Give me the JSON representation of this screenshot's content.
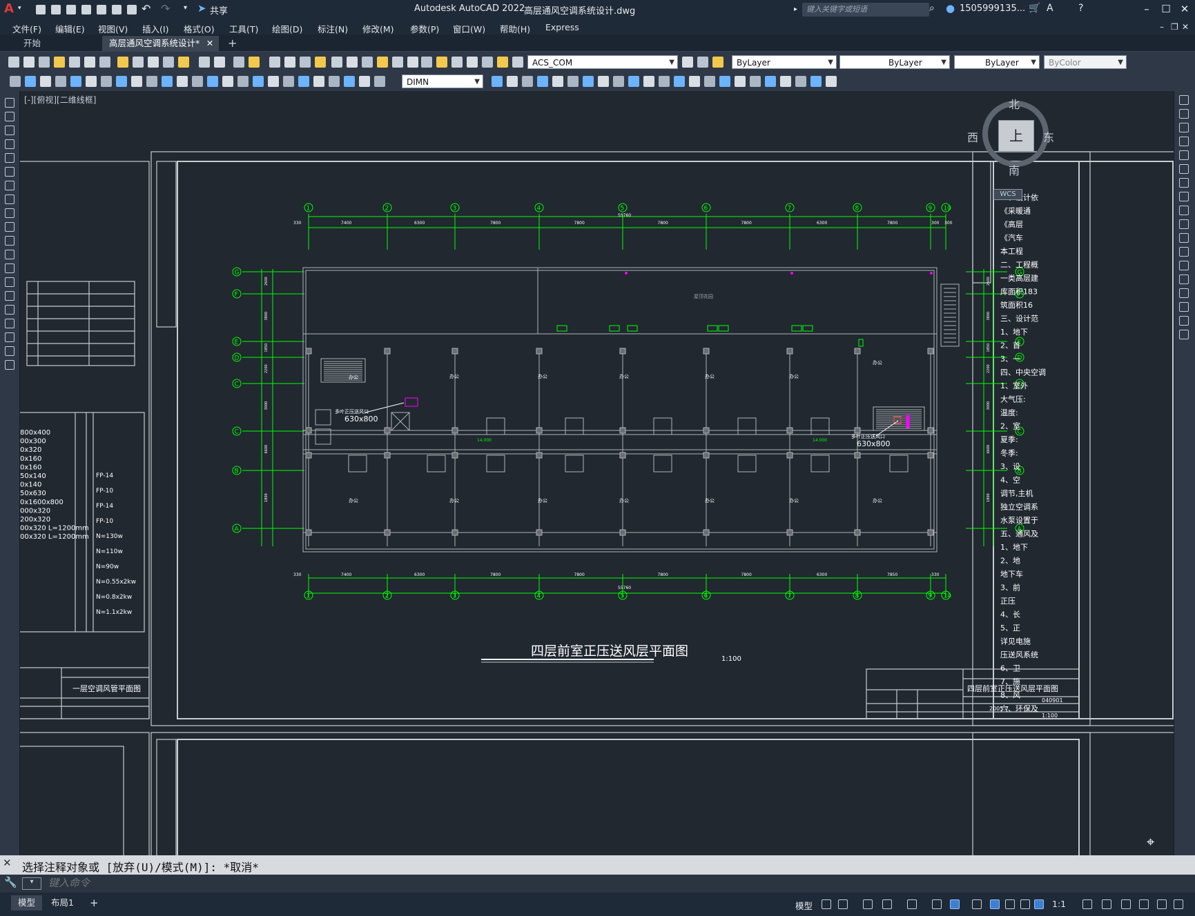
{
  "title_bar": {
    "app_name": "Autodesk AutoCAD 2022",
    "file_name": "高层通风空调系统设计.dwg",
    "share_label": "共享",
    "search_placeholder": "键入关键字或短语",
    "user_id": "1505999135...",
    "help_icon": "?"
  },
  "menu": {
    "items": [
      "文件(F)",
      "编辑(E)",
      "视图(V)",
      "插入(I)",
      "格式(O)",
      "工具(T)",
      "绘图(D)",
      "标注(N)",
      "修改(M)",
      "参数(P)",
      "窗口(W)",
      "帮助(H)",
      "Express"
    ]
  },
  "tabs": {
    "items": [
      {
        "label": "开始"
      },
      {
        "label": "高层通风空调系统设计*",
        "active": true
      }
    ],
    "add_label": "+"
  },
  "properties": {
    "layer": "ACS_COM",
    "color": "ByLayer",
    "linetype": "ByLayer",
    "lineweight": "ByLayer",
    "plotstyle": "ByColor",
    "dimstyle": "DIMN"
  },
  "viewport": {
    "label": "[-][俯视][二维线框]",
    "viewcube": {
      "north": "北",
      "south": "南",
      "east": "东",
      "west": "西",
      "top": "上",
      "wcs": "WCS"
    }
  },
  "drawing": {
    "main_title": "四层前室正压送风层平面图",
    "scale": "1:100",
    "total_dim": "55760",
    "top_dims": [
      "330",
      "7400",
      "6300",
      "7800",
      "7800",
      "7800",
      "7800",
      "6300",
      "7800",
      "300",
      "300"
    ],
    "bottom_dims": [
      "330",
      "7400",
      "6300",
      "7800",
      "7800",
      "7800",
      "7800",
      "6300",
      "7850",
      "330"
    ],
    "col_axes": [
      "1",
      "2",
      "3",
      "4",
      "5",
      "6",
      "7",
      "8",
      "9",
      "10"
    ],
    "row_axes": [
      "G",
      "F",
      "E",
      "D",
      "C",
      "B",
      "A"
    ],
    "row_dims": [
      "2600",
      "3800",
      "1850",
      "2200",
      "3000",
      "6600",
      "1800"
    ],
    "vent_label_1": "多叶正压送风口",
    "vent_size_1": "630x800",
    "vent_label_2": "多叶正压送风口",
    "vent_size_2": "630x800",
    "elev_1": "14.000",
    "elev_2": "14.000",
    "roof_label": "屋顶花园",
    "room_label": "办公",
    "title_block_right": "四层前室正压送风层平面图",
    "title_block_left": "一层空调风管平面图",
    "tb_number": "040901",
    "tb_date": "2005.7",
    "tb_scale": "1:100",
    "left_sheet_rows": [
      "800x400",
      "00x300",
      "0x320",
      "0x160",
      "0x160",
      "50x140",
      "0x140",
      "50x630",
      "0x1600x800",
      "000x320",
      "200x320",
      "00x320 L=1200mm",
      "00x320 L=1200mm"
    ],
    "left_sheet_notes": [
      "FP-14",
      "FP-10",
      "FP-14",
      "FP-10",
      "N=130w",
      "N=110w",
      "N=90w",
      "N=0.55x2kw",
      "N=0.8x2kw",
      "N=1.1x2kw"
    ],
    "right_sheet_notes": [
      "一、设计依",
      "《采暖通",
      "《高层",
      "《汽车",
      "本工程",
      "二、工程概",
      "一类高层建",
      "库面积183",
      "筑面积16",
      "三、设计范",
      "1、地下",
      "2、首",
      "3、一",
      "四、中央空调",
      "1、室外",
      "大气压:",
      "温度:",
      "2、室",
      "夏季:",
      "冬季:",
      "3、设",
      "4、空",
      "调节,主机",
      "独立空调系",
      "水泵设置于",
      "五、通风及",
      "1、地下",
      "2、地",
      "地下车",
      "3、前",
      "正压",
      "4、长",
      "5、正",
      "详见电施",
      "压送风系统",
      "6、卫",
      "7、施",
      "8、风",
      "六、环保及"
    ]
  },
  "command": {
    "history": "选择注释对象或 [放弃(U)/模式(M)]: *取消*",
    "placeholder": "键入命令"
  },
  "status_bar": {
    "tabs": [
      "模型",
      "布局1"
    ],
    "model_label": "模型",
    "scale": "1:1"
  },
  "colors": {
    "background": "#212830",
    "grid_green": "#00ff00",
    "wall_gray": "#b0b4b8",
    "accent_magenta": "#ff00ff",
    "toolbar_bg": "#2e3846"
  }
}
